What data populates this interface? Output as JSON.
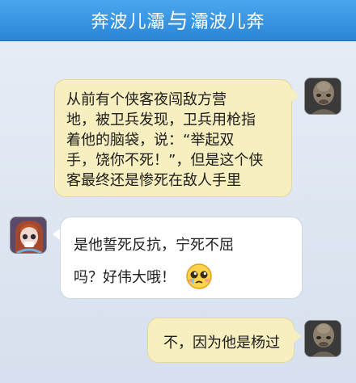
{
  "header": {
    "title_left": "奔波儿灞",
    "separator": "与",
    "title_right": "灞波儿奔"
  },
  "messages": [
    {
      "side": "right",
      "lines": [
        "从前有个侠客夜闯敌方营",
        "地，被卫兵发现，卫兵用枪指",
        "着他的脑袋，说：“举起双",
        "手，饶你不死！”，但是这个侠",
        "客最终还是惨死在敌人手里"
      ]
    },
    {
      "side": "left",
      "lines": [
        "是他誓死反抗，宁死不屈",
        "吗？好伟大哦！"
      ],
      "emoji": "teary-eyed-face-icon"
    },
    {
      "side": "right",
      "lines": [
        "不，因为他是杨过"
      ]
    }
  ]
}
